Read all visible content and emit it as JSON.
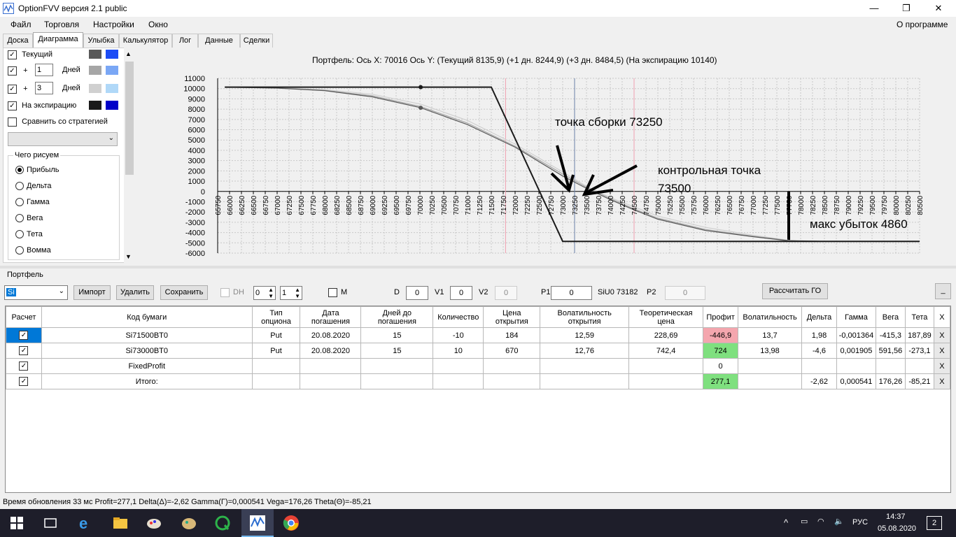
{
  "window": {
    "title": "OptionFVV версия 2.1 public",
    "minimize": "—",
    "restore": "❐",
    "close": "✕"
  },
  "menu": {
    "file": "Файл",
    "trade": "Торговля",
    "settings": "Настройки",
    "window": "Окно",
    "about": "О программе"
  },
  "tabs": [
    "Доска",
    "Диаграмма",
    "Улыбка",
    "Калькулятор",
    "Лог",
    "Данные",
    "Сделки"
  ],
  "left": {
    "current": "Текущий",
    "plus": "+",
    "days1": "1",
    "days2": "3",
    "days_label": "Дней",
    "expiration": "На экспирацию",
    "compare": "Сравнить со стратегией",
    "what_draw": "Чего рисуем",
    "radios": [
      "Прибыль",
      "Дельта",
      "Гамма",
      "Вега",
      "Тета",
      "Вомма"
    ],
    "colors": {
      "current": [
        "#595959",
        "#1c4cf5"
      ],
      "plus1": [
        "#a6a6a6",
        "#7aa7f5"
      ],
      "plus3": [
        "#d0d0d0",
        "#b0d8f8"
      ],
      "expiration": [
        "#1a1a1a",
        "#0000c8"
      ]
    }
  },
  "chart": {
    "header": "Портфель: Ось X: 70016 Ось Y:  (Текущий 8135,9)  (+1 дн. 8244,9)  (+3 дн. 8484,5)  (На экспирацию 10140)",
    "annot_assembly": "точка сборки 73250",
    "annot_control_1": "контрольная точка",
    "annot_control_2": "73500",
    "annot_maxloss": "макс убыток 4860"
  },
  "chart_data": {
    "type": "line",
    "xlim": [
      65750,
      80500
    ],
    "ylim": [
      -6000,
      11000
    ],
    "x_ticks": [
      65750,
      66000,
      66250,
      66500,
      66750,
      67000,
      67250,
      67500,
      67750,
      68000,
      68250,
      68500,
      68750,
      69000,
      69250,
      69500,
      69750,
      70000,
      70250,
      70500,
      70750,
      71000,
      71250,
      71500,
      71750,
      72000,
      72250,
      72500,
      72750,
      73000,
      73250,
      73500,
      73750,
      74000,
      74250,
      74500,
      74750,
      75000,
      75250,
      75500,
      75750,
      76000,
      76250,
      76500,
      76750,
      77000,
      77250,
      77500,
      77750,
      78000,
      78250,
      78500,
      78750,
      79000,
      79250,
      79500,
      79750,
      80000,
      80250,
      80500
    ],
    "y_ticks": [
      11000,
      10000,
      9000,
      8000,
      7000,
      6000,
      5000,
      4000,
      3000,
      2000,
      1000,
      0,
      -1000,
      -2000,
      -3000,
      -4000,
      -5000,
      -6000
    ],
    "vlines": [
      {
        "x": 71800,
        "color": "#f0a0b0"
      },
      {
        "x": 73250,
        "color": "#6a7fa8"
      },
      {
        "x": 74500,
        "color": "#f0a0b0"
      },
      {
        "x": 77750,
        "color": "#000000"
      }
    ],
    "series": [
      {
        "points": [
          [
            65900,
            10140
          ],
          [
            71500,
            10140
          ],
          [
            73000,
            -4860
          ],
          [
            80500,
            -4860
          ]
        ],
        "color": "#1a1a1a"
      },
      {
        "points": [
          [
            65900,
            10140
          ],
          [
            67000,
            10050
          ],
          [
            68000,
            9800
          ],
          [
            69000,
            9200
          ],
          [
            70016,
            8136
          ],
          [
            71000,
            6500
          ],
          [
            72000,
            4300
          ],
          [
            73000,
            1500
          ],
          [
            73500,
            300
          ],
          [
            74000,
            -800
          ],
          [
            74500,
            -1800
          ],
          [
            75000,
            -2700
          ],
          [
            76000,
            -3800
          ],
          [
            77000,
            -4400
          ],
          [
            77750,
            -4800
          ],
          [
            78500,
            -4860
          ],
          [
            80500,
            -4860
          ]
        ],
        "color": "#595959"
      },
      {
        "points": [
          [
            65900,
            10140
          ],
          [
            67000,
            10060
          ],
          [
            68000,
            9830
          ],
          [
            69000,
            9300
          ],
          [
            70016,
            8245
          ],
          [
            71000,
            6650
          ],
          [
            72000,
            4400
          ],
          [
            73000,
            1700
          ],
          [
            73500,
            400
          ],
          [
            74000,
            -700
          ],
          [
            74500,
            -1700
          ],
          [
            75000,
            -2600
          ],
          [
            76000,
            -3700
          ],
          [
            77000,
            -4350
          ],
          [
            77750,
            -4780
          ],
          [
            78500,
            -4860
          ],
          [
            80500,
            -4860
          ]
        ],
        "color": "#a6a6a6"
      },
      {
        "points": [
          [
            65900,
            10140
          ],
          [
            67000,
            10080
          ],
          [
            68000,
            9900
          ],
          [
            69000,
            9450
          ],
          [
            70016,
            8485
          ],
          [
            71000,
            6900
          ],
          [
            72000,
            4600
          ],
          [
            73000,
            1900
          ],
          [
            73500,
            500
          ],
          [
            74000,
            -600
          ],
          [
            74500,
            -1500
          ],
          [
            75000,
            -2400
          ],
          [
            76000,
            -3500
          ],
          [
            77000,
            -4250
          ],
          [
            77750,
            -4750
          ],
          [
            78500,
            -4860
          ],
          [
            80500,
            -4860
          ]
        ],
        "color": "#d0d0d0"
      }
    ],
    "markers": [
      {
        "x": 70016,
        "y": 10140
      },
      {
        "x": 70016,
        "y": 8136
      }
    ]
  },
  "portfolio": {
    "label": "Портфель",
    "select_value": "Si",
    "import": "Импорт",
    "delete": "Удалить",
    "save": "Сохранить",
    "dh": "DH",
    "spin1": "0",
    "spin2": "1",
    "m": "M",
    "d_label": "D",
    "d_value": "0",
    "v1_label": "V1",
    "v1_value": "0",
    "v2_label": "V2",
    "v2_value": "0",
    "p1_label": "P1",
    "p1_value": "0",
    "siu": "SiU0 73182",
    "p2_label": "P2",
    "p2_value": "0",
    "calc_go": "Рассчитать ГО",
    "mini": "_"
  },
  "table": {
    "headers": [
      "Расчет",
      "Код бумаги",
      "Тип\nопциона",
      "Дата\nпогашения",
      "Дней до\nпогашения",
      "Количество",
      "Цена\nоткрытия",
      "Волатильность\nоткрытия",
      "Теоретическая\nцена",
      "Профит",
      "Волатильность",
      "Дельта",
      "Гамма",
      "Вега",
      "Тета",
      "X"
    ],
    "rows": [
      {
        "code": "Si71500BT0",
        "type": "Put",
        "date": "20.08.2020",
        "days": "15",
        "qty": "-10",
        "price": "184",
        "vol_open": "12,59",
        "theor": "228,69",
        "profit": "-446,9",
        "vol": "13,7",
        "delta": "1,98",
        "gamma": "-0,001364",
        "vega": "-415,3",
        "theta": "187,89",
        "x": "X"
      },
      {
        "code": "Si73000BT0",
        "type": "Put",
        "date": "20.08.2020",
        "days": "15",
        "qty": "10",
        "price": "670",
        "vol_open": "12,76",
        "theor": "742,4",
        "profit": "724",
        "vol": "13,98",
        "delta": "-4,6",
        "gamma": "0,001905",
        "vega": "591,56",
        "theta": "-273,1",
        "x": "X"
      },
      {
        "code": "FixedProfit",
        "type": "",
        "date": "",
        "days": "",
        "qty": "",
        "price": "",
        "vol_open": "",
        "theor": "",
        "profit": "0",
        "vol": "",
        "delta": "",
        "gamma": "",
        "vega": "",
        "theta": "",
        "x": "X"
      },
      {
        "code": "Итого:",
        "type": "",
        "date": "",
        "days": "",
        "qty": "",
        "price": "",
        "vol_open": "",
        "theor": "",
        "profit": "277,1",
        "vol": "",
        "delta": "-2,62",
        "gamma": "0,000541",
        "vega": "176,26",
        "theta": "-85,21",
        "x": "X"
      }
    ],
    "profit_colors": [
      "#f4a6ae",
      "#7fe07f",
      "",
      "#7fe07f"
    ]
  },
  "status": "Время обновления 33 мс  Profit=277,1 Delta(Δ)=-2,62 Gamma(Γ)=0,000541 Vega=176,26 Theta(Θ)=-85,21",
  "taskbar": {
    "lang": "РУС",
    "time": "14:37",
    "date": "05.08.2020",
    "notif": "2"
  }
}
